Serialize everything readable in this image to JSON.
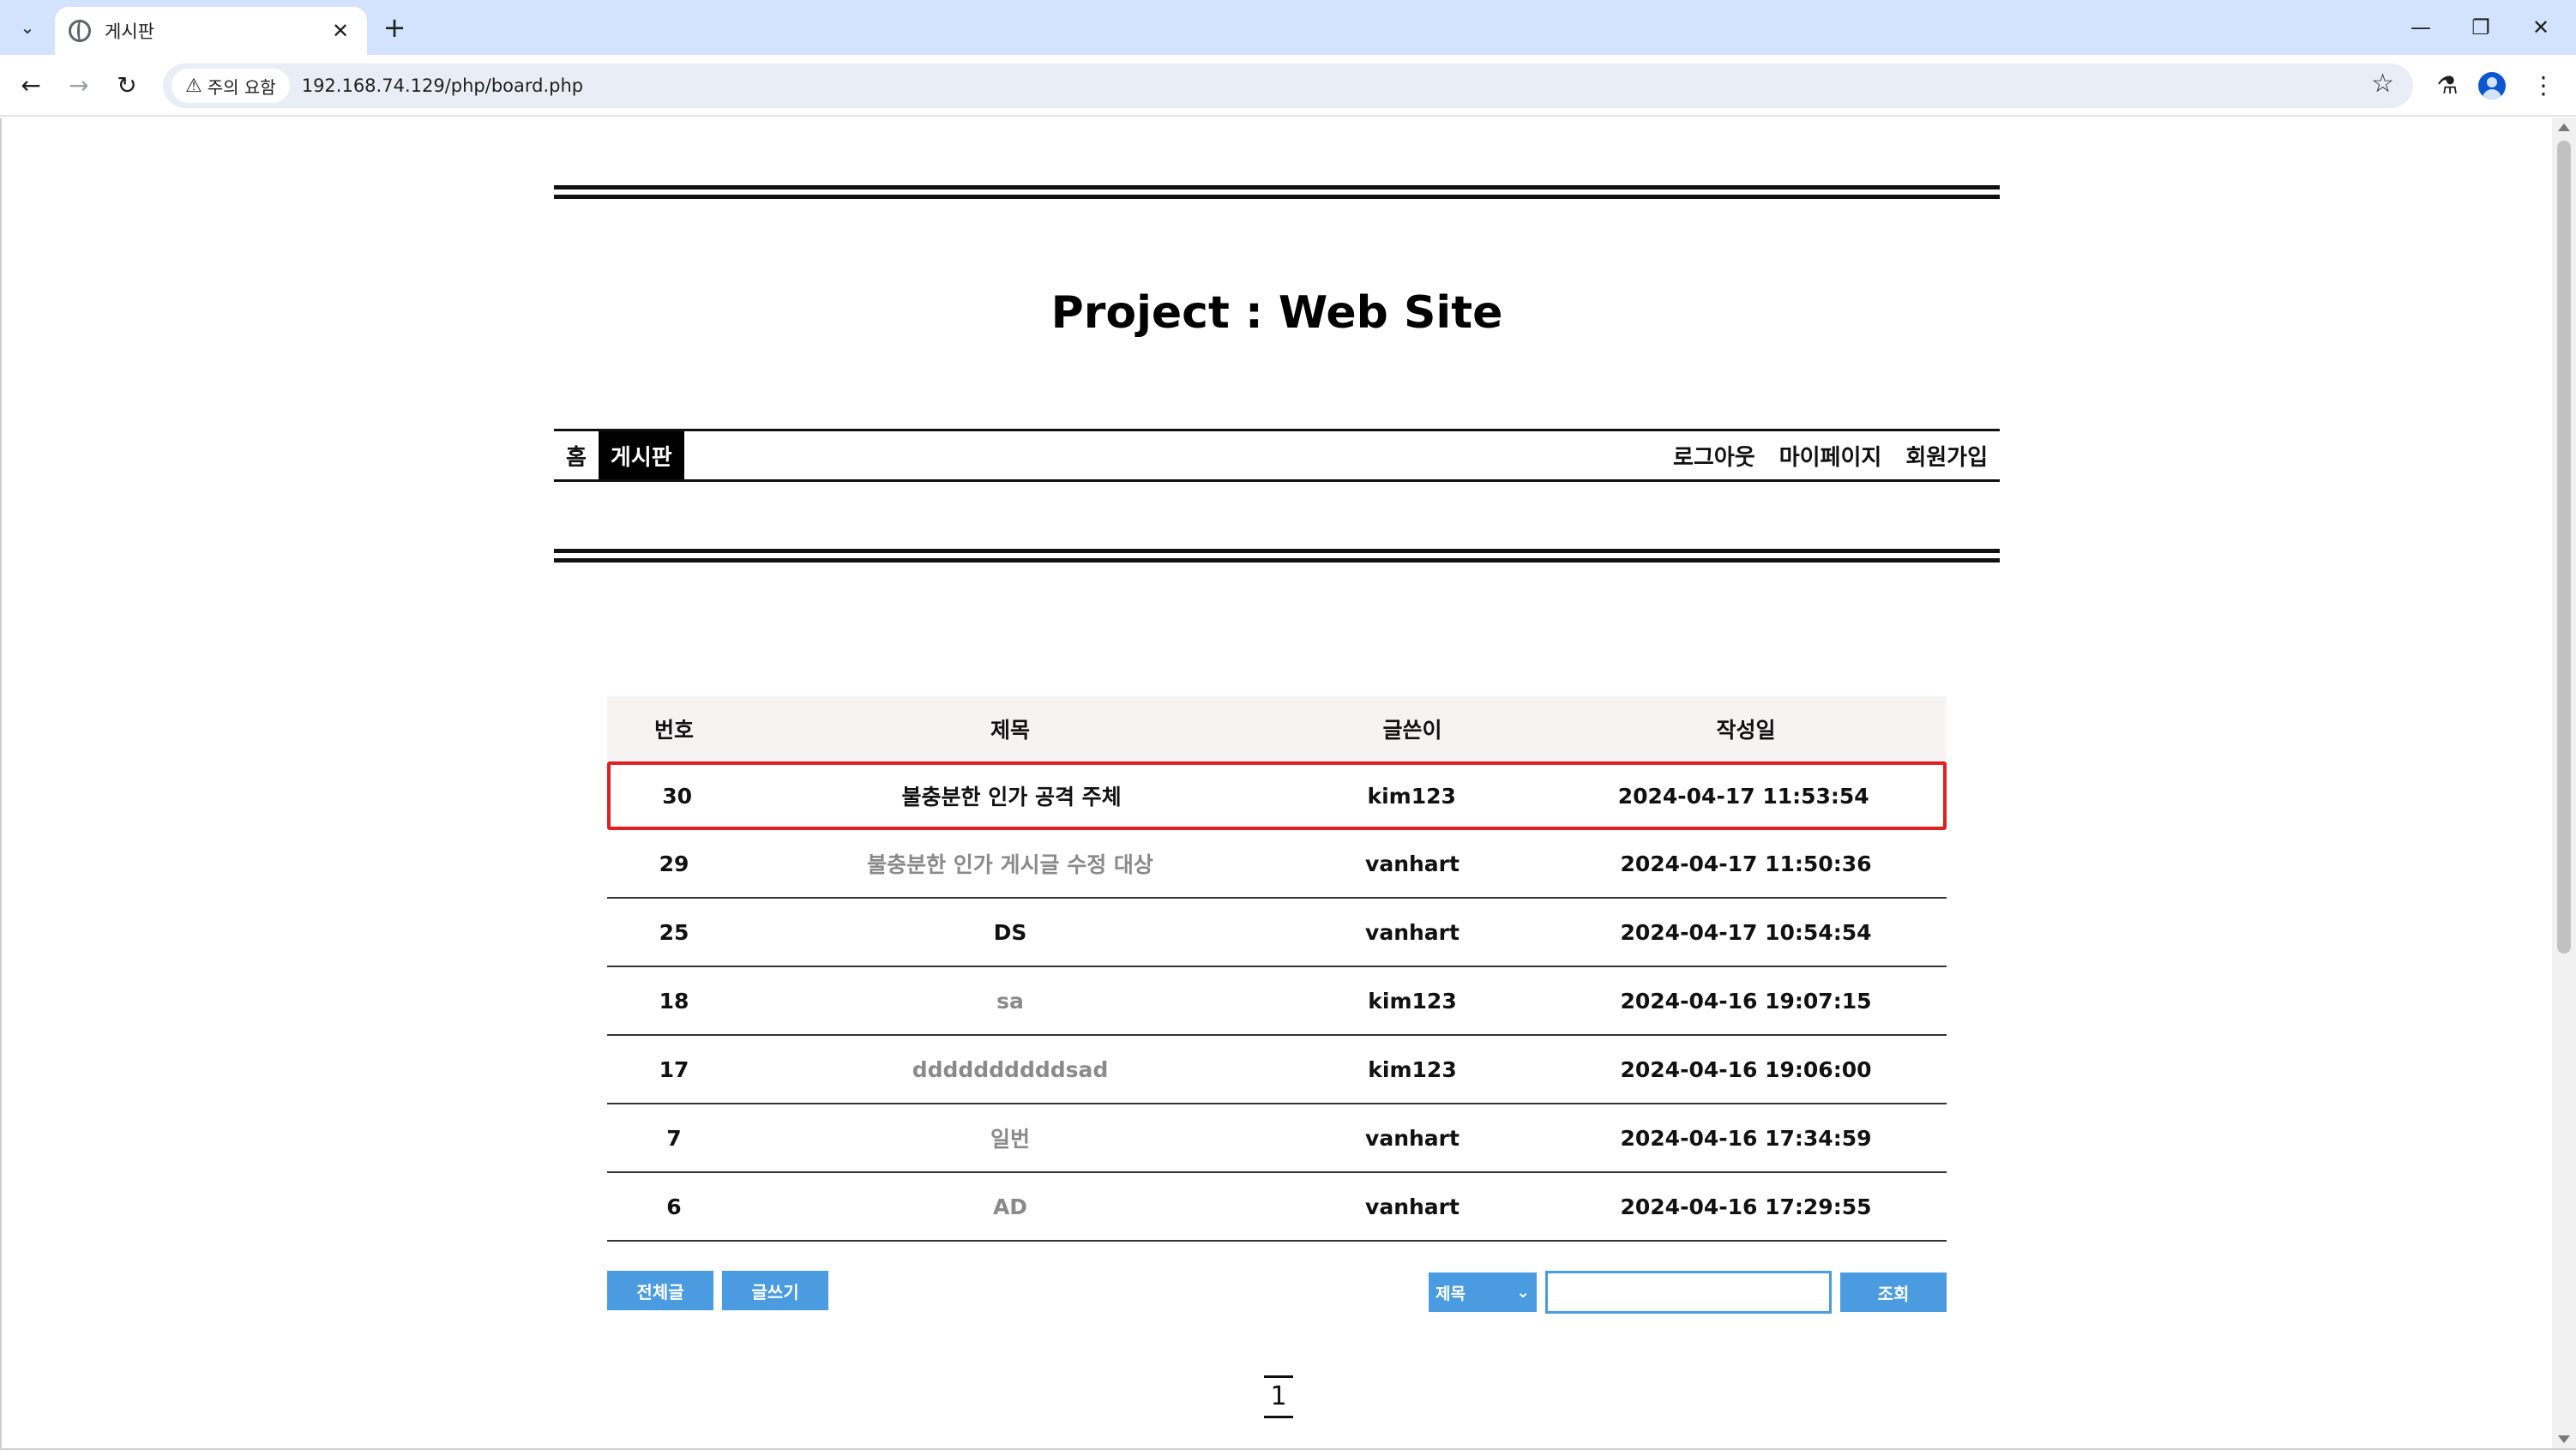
{
  "browser": {
    "tab_title": "게시판",
    "security_chip": "주의 요함",
    "url": "192.168.74.129/php/board.php"
  },
  "site": {
    "title": "Project : Web Site"
  },
  "menu": {
    "left": [
      "홈",
      "게시판"
    ],
    "right": [
      "로그아웃",
      "마이페이지",
      "회원가입"
    ]
  },
  "board": {
    "headers": [
      "번호",
      "제목",
      "글쓴이",
      "작성일"
    ],
    "rows": [
      {
        "no": "30",
        "title": "불충분한 인가 공격 주체",
        "writer": "kim123",
        "date": "2024-04-17 11:53:54"
      },
      {
        "no": "29",
        "title": "불충분한 인가 게시글 수정 대상",
        "writer": "vanhart",
        "date": "2024-04-17 11:50:36"
      },
      {
        "no": "25",
        "title": "DS",
        "writer": "vanhart",
        "date": "2024-04-17 10:54:54"
      },
      {
        "no": "18",
        "title": "sa",
        "writer": "kim123",
        "date": "2024-04-16 19:07:15"
      },
      {
        "no": "17",
        "title": "ddddddddddsad",
        "writer": "kim123",
        "date": "2024-04-16 19:06:00"
      },
      {
        "no": "7",
        "title": "일번",
        "writer": "vanhart",
        "date": "2024-04-16 17:34:59"
      },
      {
        "no": "6",
        "title": "AD",
        "writer": "vanhart",
        "date": "2024-04-16 17:29:55"
      }
    ]
  },
  "actions": {
    "all_posts": "전체글",
    "write": "글쓰기",
    "search_field": "제목",
    "search_value": "",
    "search_button": "조회"
  },
  "pagination": {
    "current": "1"
  },
  "colors": {
    "accent": "#4a9be0",
    "highlight": "#e02020",
    "tabstrip": "#d3e3fd"
  }
}
